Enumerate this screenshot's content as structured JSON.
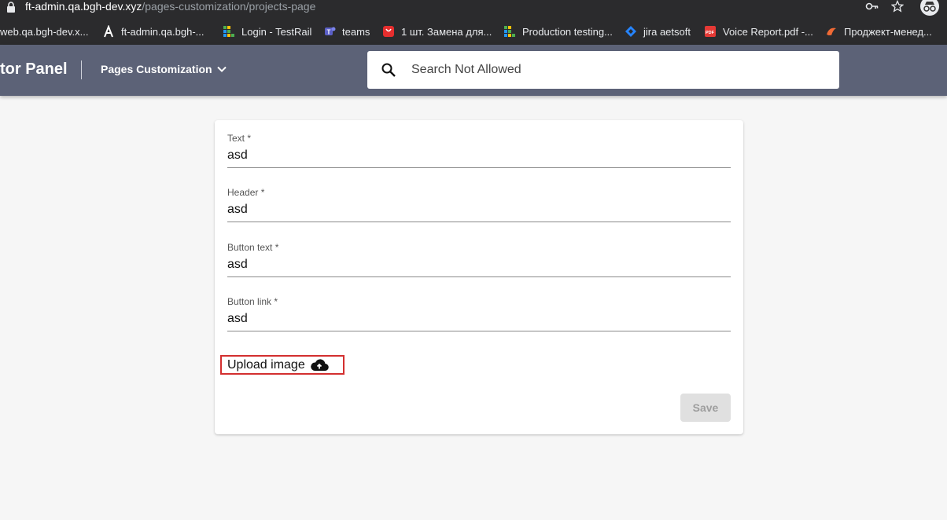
{
  "browser": {
    "url_host": "ft-admin.qa.bgh-dev.xyz",
    "url_path": "/pages-customization/projects-page"
  },
  "bookmarks": [
    {
      "label": "web.qa.bgh-dev.x...",
      "icon": "globe-icon"
    },
    {
      "label": "ft-admin.qa.bgh-...",
      "icon": "a-logo-icon"
    },
    {
      "label": "Login - TestRail",
      "icon": "testrail-icon"
    },
    {
      "label": "teams",
      "icon": "teams-icon"
    },
    {
      "label": "1 шт. Замена для...",
      "icon": "shop-icon"
    },
    {
      "label": "Production testing...",
      "icon": "testrail-icon"
    },
    {
      "label": "jira aetsoft",
      "icon": "jira-icon"
    },
    {
      "label": "Voice Report.pdf -...",
      "icon": "pdf-icon"
    },
    {
      "label": "Проджект-менед...",
      "icon": "skype-icon"
    }
  ],
  "header": {
    "brand": "tor Panel",
    "menu_label": "Pages Customization",
    "search_placeholder": "Search Not Allowed"
  },
  "form": {
    "fields": [
      {
        "label": "Text *",
        "value": "asd"
      },
      {
        "label": "Header *",
        "value": "asd"
      },
      {
        "label": "Button text *",
        "value": "asd"
      },
      {
        "label": "Button link *",
        "value": "asd"
      }
    ],
    "upload_label": "Upload image",
    "save_label": "Save"
  },
  "colors": {
    "header_bg": "#5c6277",
    "highlight": "#d32f2f",
    "save_disabled_bg": "#e0e0e0"
  }
}
